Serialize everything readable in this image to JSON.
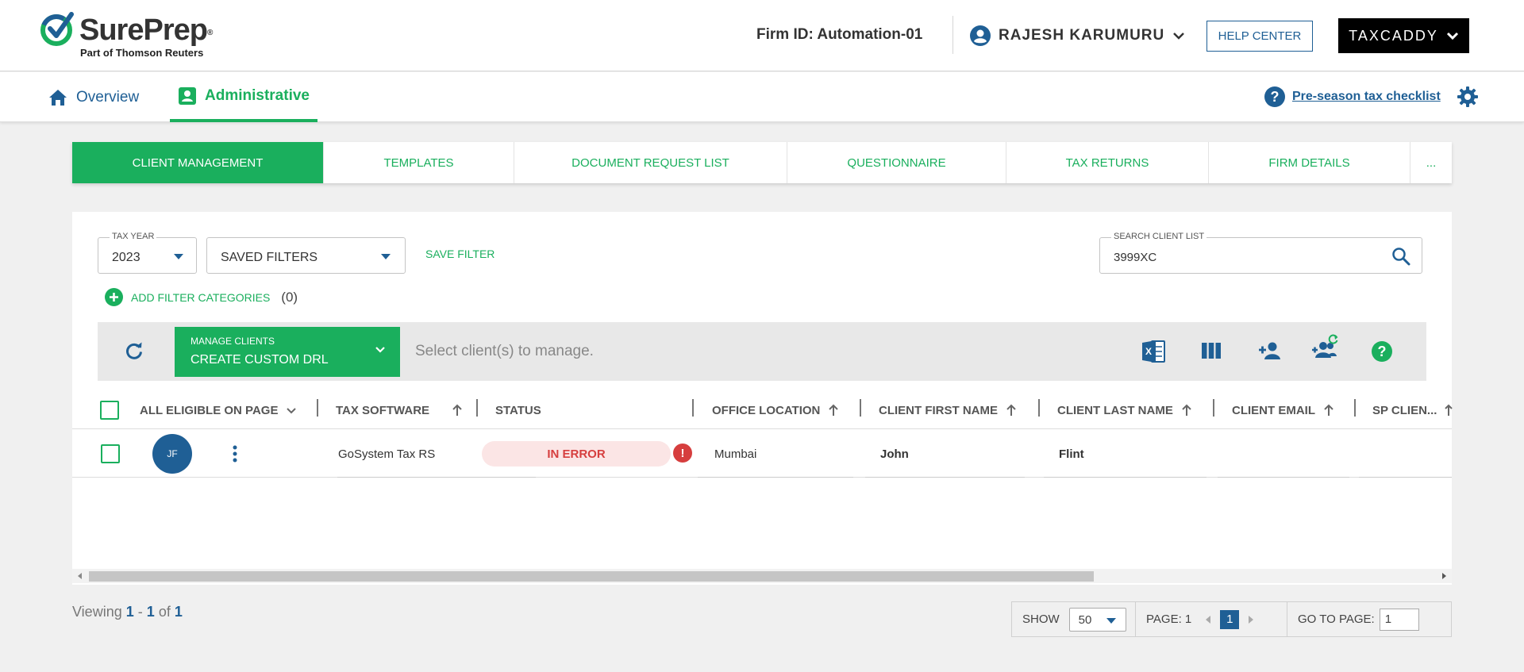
{
  "header": {
    "logo_name": "SurePrep",
    "logo_reg": "®",
    "logo_sub": "Part of Thomson Reuters",
    "firm_id": "Firm ID: Automation-01",
    "user_name": "RAJESH KARUMURU",
    "help_center": "HELP CENTER",
    "taxcaddy": "TAXCADDY"
  },
  "nav": {
    "overview": "Overview",
    "administrative": "Administrative",
    "checklist": "Pre-season tax checklist"
  },
  "tabs": [
    {
      "label": "CLIENT MANAGEMENT",
      "active": true
    },
    {
      "label": "TEMPLATES",
      "active": false
    },
    {
      "label": "DOCUMENT REQUEST LIST",
      "active": false
    },
    {
      "label": "QUESTIONNAIRE",
      "active": false
    },
    {
      "label": "TAX RETURNS",
      "active": false
    },
    {
      "label": "FIRM DETAILS",
      "active": false
    },
    {
      "label": "...",
      "active": false
    }
  ],
  "filters": {
    "tax_year_label": "TAX YEAR",
    "tax_year_value": "2023",
    "saved_filters": "SAVED FILTERS",
    "save_filter": "SAVE FILTER",
    "search_label": "SEARCH CLIENT LIST",
    "search_value": "3999XC",
    "add_filter": "ADD FILTER CATEGORIES",
    "add_filter_count": "(0)"
  },
  "toolbar": {
    "manage_label": "MANAGE CLIENTS",
    "manage_value": "CREATE CUSTOM DRL",
    "hint": "Select client(s) to manage."
  },
  "table": {
    "columns": {
      "eligible": "ALL ELIGIBLE ON PAGE",
      "tax_software": "TAX SOFTWARE",
      "status": "STATUS",
      "office": "OFFICE LOCATION",
      "first_name": "CLIENT FIRST NAME",
      "last_name": "CLIENT LAST NAME",
      "email": "CLIENT EMAIL",
      "sp_client": "SP CLIEN..."
    },
    "rows": [
      {
        "initials": "JF",
        "tax_software": "GoSystem Tax RS",
        "status": "IN ERROR",
        "office": "Mumbai",
        "first_name": "John",
        "last_name": "Flint",
        "email": ""
      }
    ]
  },
  "footer": {
    "viewing_prefix": "Viewing",
    "from": "1",
    "dash": "-",
    "to": "1",
    "of": "of",
    "total": "1",
    "show_label": "SHOW",
    "show_value": "50",
    "page_label": "PAGE: 1",
    "current_page": "1",
    "goto_label": "GO TO PAGE:",
    "goto_value": "1"
  },
  "colors": {
    "green": "#1aaf5d",
    "blue": "#1f5f95",
    "error": "#d63e3e"
  }
}
